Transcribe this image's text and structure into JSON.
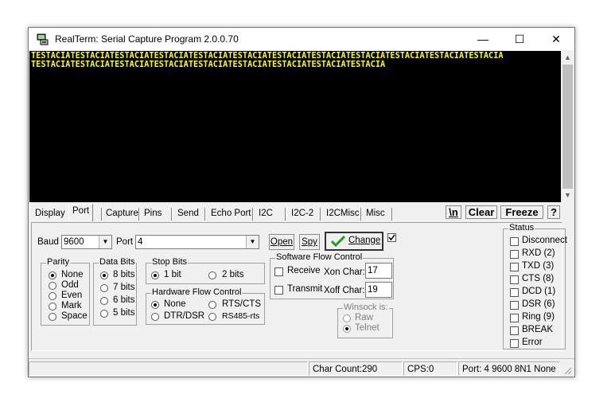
{
  "window": {
    "title": "RealTerm: Serial Capture Program 2.0.0.70",
    "minimize": "—",
    "maximize": "☐",
    "close": "✕"
  },
  "terminal": {
    "lines": [
      "TESTACIATESTACIATESTACIATESTACIATESTACIATESTACIATESTACIATESTACIATESTACIATESTACIATESTACIATESTACIA",
      "TESTACIATESTACIATESTACIATESTACIATESTACIATESTACIATESTACIATESTACIATESTACIA"
    ],
    "text_color": "#ffff00",
    "background": "#000000"
  },
  "tabs": [
    "Display",
    "Port",
    "Capture",
    "Pins",
    "Send",
    "Echo Port",
    "I2C",
    "I2C-2",
    "I2CMisc",
    "Misc"
  ],
  "selected_tab": "Port",
  "toolbar": {
    "newline": "\\n",
    "clear": "Clear",
    "freeze": "Freeze",
    "help": "?"
  },
  "port": {
    "baud_label": "Baud",
    "baud_value": "9600",
    "port_label": "Port",
    "port_value": "4",
    "open": "Open",
    "spy": "Spy",
    "change": "Change",
    "change_checked": true
  },
  "parity": {
    "title": "Parity",
    "options": [
      "None",
      "Odd",
      "Even",
      "Mark",
      "Space"
    ],
    "selected": "None"
  },
  "data_bits": {
    "title": "Data Bits",
    "options": [
      "8 bits",
      "7 bits",
      "6 bits",
      "5 bits"
    ],
    "selected": "8 bits"
  },
  "stop_bits": {
    "title": "Stop Bits",
    "options": [
      "1 bit",
      "2 bits"
    ],
    "selected": "1 bit"
  },
  "hw_flow": {
    "title": "Hardware Flow Control",
    "options": [
      "None",
      "RTS/CTS",
      "DTR/DSR",
      "RS485-rts"
    ],
    "selected": "None"
  },
  "sw_flow": {
    "title": "Software Flow Control",
    "receive": "Receive",
    "transmit": "Transmit",
    "xon_label": "Xon Char:",
    "xon_value": "17",
    "xoff_label": "Xoff Char:",
    "xoff_value": "19"
  },
  "winsock": {
    "title": "Winsock is:",
    "options": [
      "Raw",
      "Telnet"
    ],
    "selected": "Telnet"
  },
  "status": {
    "title": "Status",
    "items": [
      "Disconnect",
      "RXD (2)",
      "TXD (3)",
      "CTS (8)",
      "DCD (1)",
      "DSR (6)",
      "Ring (9)",
      "BREAK",
      "Error"
    ]
  },
  "statusbar": {
    "char_count": "Char Count:290",
    "cps": "CPS:0",
    "port_info": "Port: 4 9600 8N1 None"
  }
}
